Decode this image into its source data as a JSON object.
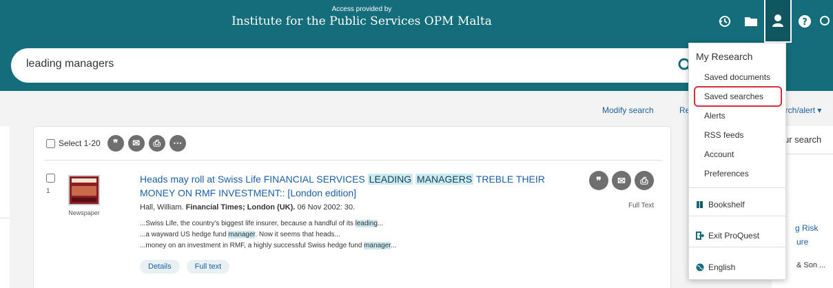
{
  "header": {
    "access_small": "Access provided by",
    "institution": "Institute for the Public Services OPM Malta",
    "icons": [
      "history-icon",
      "folder-icon",
      "user-icon",
      "help-icon",
      "search-icon"
    ]
  },
  "search": {
    "query": "leading managers"
  },
  "toolbar": {
    "modify": "Modify search",
    "re": "Re",
    "alert": "arch/alert ▾"
  },
  "results": {
    "select_label": "Select 1-20",
    "record": {
      "number": "1",
      "type": "Newspaper",
      "title_parts": {
        "a": "Heads may roll at Swiss Life FINANCIAL SERVICES ",
        "hl1": "LEADING",
        "sp": " ",
        "hl2": "MANAGERS",
        "b": " TREBLE THEIR MONEY ON RMF INVESTMENT:: [London edition]"
      },
      "byline_author": "Hall, William. ",
      "byline_source": "Financial Times; London (UK).",
      "byline_date": " 06 Nov 2002: 30.",
      "snip1_a": "...Swiss Life, the country's biggest life insurer, because a handful of its ",
      "snip1_hl": "leading",
      "snip1_b": "...",
      "snip2_a": "...a wayward US hedge fund ",
      "snip2_hl": "manager",
      "snip2_b": ". Now it seems that heads...",
      "snip3_a": "...money on an investment in RMF, a highly successful Swiss hedge fund ",
      "snip3_hl": "manager",
      "snip3_b": "...",
      "details": "Details",
      "fulltext": "Full text",
      "fulltext_label": "Full Text"
    }
  },
  "right": {
    "r1": "ur search",
    "r2": "g Risk",
    "r3": "ure",
    "r4": "& Son ..."
  },
  "dropdown": {
    "header": "My Research",
    "items": [
      "Saved documents",
      "Saved searches",
      "Alerts",
      "RSS feeds",
      "Account",
      "Preferences"
    ],
    "selected": "Saved searches",
    "bookshelf": "Bookshelf",
    "exit": "Exit ProQuest",
    "language": "English"
  },
  "colors": {
    "teal": "#146d7a",
    "link": "#1a5fa3",
    "highlight": "#cdeaf0",
    "focus_border": "#d32f3f"
  }
}
